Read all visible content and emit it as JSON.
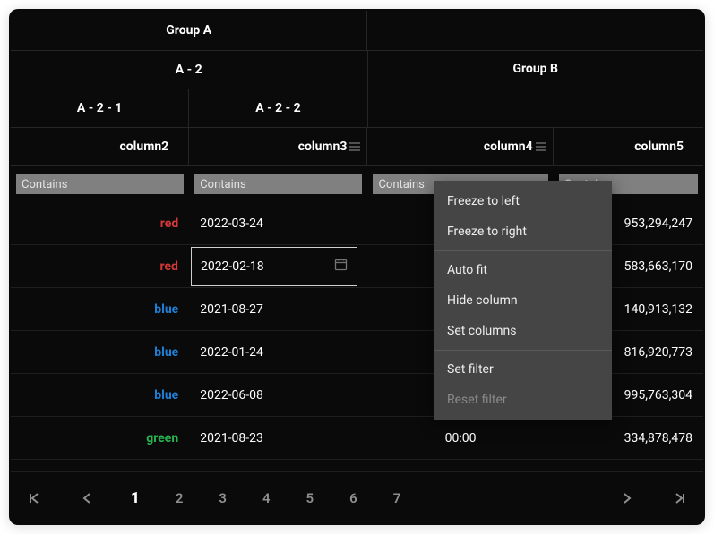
{
  "header": {
    "groupA": "Group A",
    "groupB": "Group B",
    "a2": "A - 2",
    "a21": "A - 2 - 1",
    "a22": "A - 2 - 2",
    "col2": "column2",
    "col3": "column3",
    "col4": "column4",
    "col5": "column5"
  },
  "filter_placeholder": "Contains",
  "rows": [
    {
      "c2": "red",
      "c2_color": "red",
      "c3": "2022-03-24",
      "c4": "",
      "c5": "953,294,247",
      "editing": false
    },
    {
      "c2": "red",
      "c2_color": "red",
      "c3": "2022-02-18",
      "c4": "",
      "c5": "583,663,170",
      "editing": true
    },
    {
      "c2": "blue",
      "c2_color": "blue",
      "c3": "2021-08-27",
      "c4": "",
      "c5": "140,913,132",
      "editing": false
    },
    {
      "c2": "blue",
      "c2_color": "blue",
      "c3": "2022-01-24",
      "c4": "",
      "c5": "816,920,773",
      "editing": false
    },
    {
      "c2": "blue",
      "c2_color": "blue",
      "c3": "2022-06-08",
      "c4": "",
      "c5": "995,763,304",
      "editing": false
    },
    {
      "c2": "green",
      "c2_color": "green",
      "c3": "2021-08-23",
      "c4": "00:00",
      "c5": "334,878,478",
      "editing": false
    }
  ],
  "paginator": {
    "pages": [
      "1",
      "2",
      "3",
      "4",
      "5",
      "6",
      "7"
    ],
    "active": "1"
  },
  "context_menu": {
    "freeze_left": "Freeze to left",
    "freeze_right": "Freeze to right",
    "auto_fit": "Auto fit",
    "hide_column": "Hide column",
    "set_columns": "Set columns",
    "set_filter": "Set filter",
    "reset_filter": "Reset filter"
  }
}
